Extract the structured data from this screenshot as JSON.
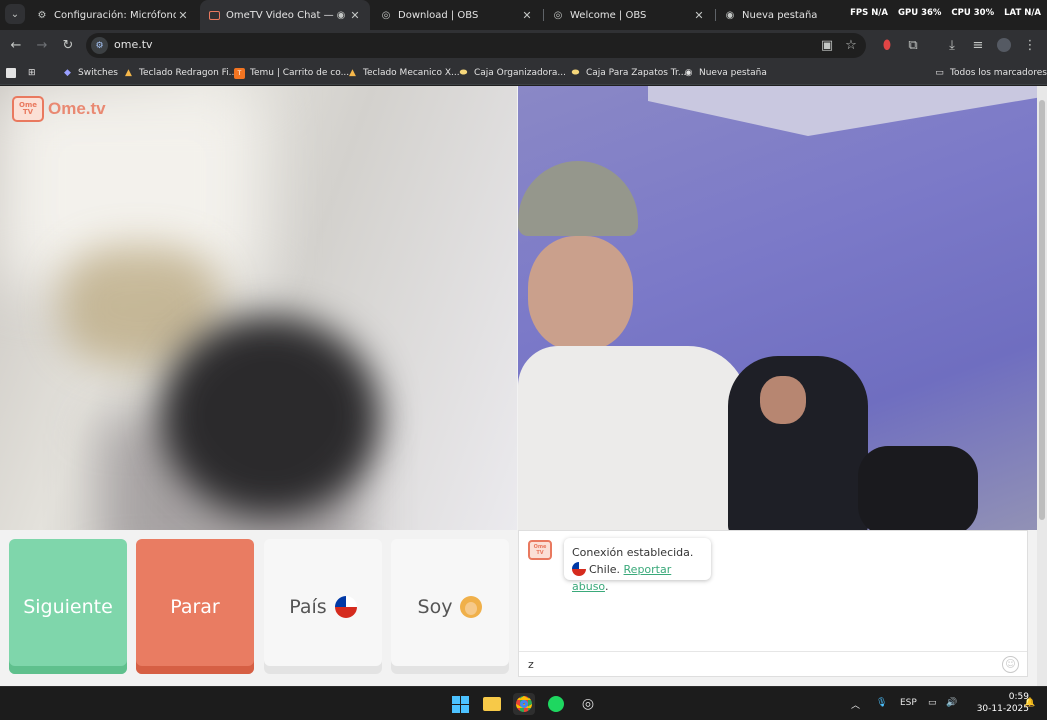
{
  "browser": {
    "tabs": [
      {
        "title": "Configuración: Micrófono",
        "icon": "gear-icon"
      },
      {
        "title": "OmeTV Video Chat — Ome",
        "icon": "ometv-favicon",
        "active": true
      },
      {
        "title": "Download | OBS",
        "icon": "obs-icon"
      },
      {
        "title": "Welcome | OBS",
        "icon": "obs-icon"
      },
      {
        "title": "Nueva pestaña",
        "icon": "chrome-icon"
      }
    ],
    "perf": {
      "fps": "FPS N/A",
      "gpu": "GPU 36%",
      "cpu": "CPU 30%",
      "lat": "LAT N/A"
    },
    "url": "ome.tv",
    "bookmarks": [
      {
        "label": "Switches",
        "icon": "diamond-icon"
      },
      {
        "label": "Teclado Redragon Fi...",
        "icon": "bookmark-icon"
      },
      {
        "label": "Temu | Carrito de co...",
        "icon": "temu-icon"
      },
      {
        "label": "Teclado Mecanico X...",
        "icon": "bookmark-icon"
      },
      {
        "label": "Caja Organizadora...",
        "icon": "bookmark-icon"
      },
      {
        "label": "Caja Para Zapatos Tr...",
        "icon": "bookmark-icon"
      },
      {
        "label": "Nueva pestaña",
        "icon": "chrome-icon"
      }
    ],
    "all_bookmarks": "Todos los marcadores"
  },
  "page": {
    "logo_text": "Ome.tv",
    "logo_badge": "Ome TV",
    "buttons": {
      "next": "Siguiente",
      "stop": "Parar",
      "country": "País",
      "gender": "Soy"
    },
    "chat": {
      "status": "Conexión establecida.",
      "country": "Chile.",
      "report": "Reportar abuso",
      "report_end": ".",
      "input_value": "z"
    }
  },
  "taskbar": {
    "lang": "ESP",
    "time": "0:59",
    "date": "30-11-2025"
  }
}
